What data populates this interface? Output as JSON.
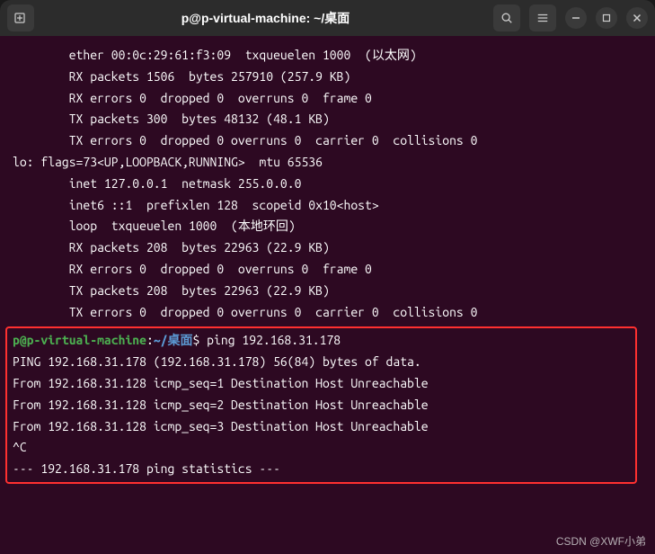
{
  "titlebar": {
    "title": "p@p-virtual-machine: ~/桌面"
  },
  "terminal": {
    "lines": [
      "        ether 00:0c:29:61:f3:09  txqueuelen 1000  (以太网)",
      "        RX packets 1506  bytes 257910 (257.9 KB)",
      "        RX errors 0  dropped 0  overruns 0  frame 0",
      "        TX packets 300  bytes 48132 (48.1 KB)",
      "        TX errors 0  dropped 0 overruns 0  carrier 0  collisions 0",
      "",
      "lo: flags=73<UP,LOOPBACK,RUNNING>  mtu 65536",
      "        inet 127.0.0.1  netmask 255.0.0.0",
      "        inet6 ::1  prefixlen 128  scopeid 0x10<host>",
      "        loop  txqueuelen 1000  (本地环回)",
      "        RX packets 208  bytes 22963 (22.9 KB)",
      "        RX errors 0  dropped 0  overruns 0  frame 0",
      "        TX packets 208  bytes 22963 (22.9 KB)",
      "        TX errors 0  dropped 0 overruns 0  carrier 0  collisions 0",
      ""
    ],
    "prompt": {
      "user": "p@p-virtual-machine",
      "colon": ":",
      "path": "~/桌面",
      "dollar": "$",
      "command": " ping 192.168.31.178"
    },
    "highlighted": [
      "PING 192.168.31.178 (192.168.31.178) 56(84) bytes of data.",
      "From 192.168.31.128 icmp_seq=1 Destination Host Unreachable",
      "From 192.168.31.128 icmp_seq=2 Destination Host Unreachable",
      "From 192.168.31.128 icmp_seq=3 Destination Host Unreachable",
      "^C",
      "--- 192.168.31.178 ping statistics ---"
    ]
  },
  "watermark": "CSDN @XWF小弟"
}
